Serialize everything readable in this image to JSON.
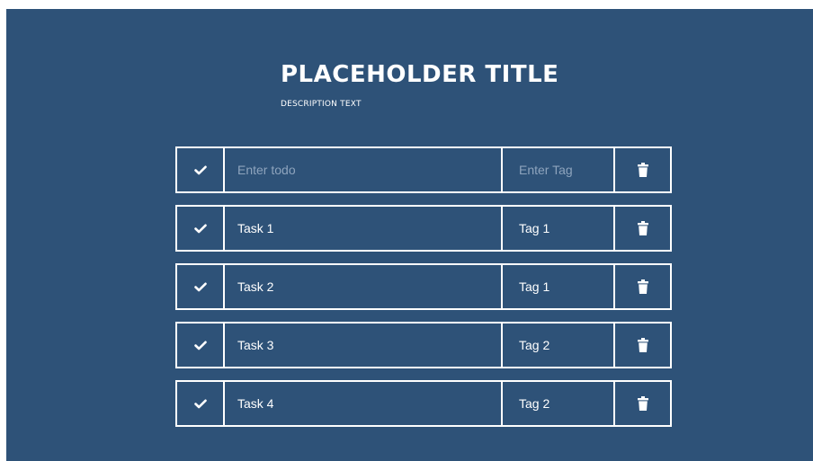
{
  "header": {
    "title": "PLACEHOLDER TITLE",
    "description": "DESCRIPTION TEXT"
  },
  "new_item": {
    "todo_placeholder": "Enter todo",
    "tag_placeholder": "Enter Tag"
  },
  "tasks": [
    {
      "label": "Task 1",
      "tag": "Tag 1"
    },
    {
      "label": "Task 2",
      "tag": "Tag 1"
    },
    {
      "label": "Task 3",
      "tag": "Tag 2"
    },
    {
      "label": "Task 4",
      "tag": "Tag 2"
    }
  ],
  "icons": {
    "check": "check-icon",
    "delete": "trash-icon"
  },
  "colors": {
    "background": "#2e5278",
    "foreground": "#ffffff",
    "placeholder": "#8ea4bd"
  }
}
